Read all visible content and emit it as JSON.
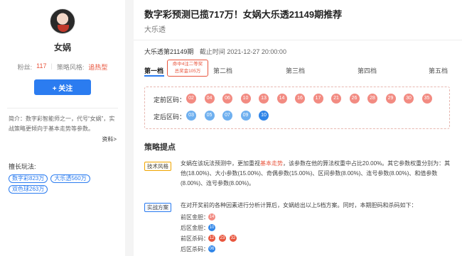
{
  "profile": {
    "name": "女娲",
    "fans_label": "粉丝:",
    "fans_count": "117",
    "style_label": "策略风格:",
    "style_value": "追热型",
    "follow_label": "+ 关注",
    "intro": "简介：数字彩智能师之一，代号“女娲”，实战策略更倾向于基本走势等参数。",
    "more_link": "资料>",
    "expertise_title": "擅长玩法:",
    "expertise_tags": [
      "数字彩823万",
      "大乐透560万",
      "双色球263万"
    ]
  },
  "article": {
    "title": "数字彩预测已揽717万！女娲大乐透21149期推荐",
    "subtitle": "大乐透",
    "issue": "大乐透第21149期",
    "deadline": "截止时间 2021-12-27 20:00:00"
  },
  "tabs": [
    {
      "label": "第一档",
      "active": true
    },
    {
      "label": "第二档",
      "active": false
    },
    {
      "label": "第三档",
      "active": false
    },
    {
      "label": "第四档",
      "active": false
    },
    {
      "label": "第五档",
      "active": false
    }
  ],
  "tab_tooltip": {
    "line1": "命中4注二等奖",
    "line2": "总奖金105万"
  },
  "balls": {
    "front_label": "定前区码：",
    "back_label": "定后区码：",
    "front": [
      "02",
      "04",
      "06",
      "10",
      "13",
      "14",
      "16",
      "17",
      "21",
      "26",
      "28",
      "29",
      "30",
      "35"
    ],
    "back": [
      "03",
      "05",
      "07",
      "09",
      "10"
    ]
  },
  "strategy": {
    "section_title": "策略提点",
    "tech_label": "技术风格",
    "tech_text_before": "女娲在该玩法预测中，更加重视",
    "tech_highlight": "基本走势",
    "tech_text_after": "，该参数在他的算法权重中占比20.00%。其它参数权重分别为：其他(18.00%)、大小参数(15.00%)、奇偶参数(15.00%)、区间参数(8.00%)、连号参数(8.00%)、和值参数(8.00%)、连号参数(8.00%)。",
    "plan_label": "实战方案",
    "plan_text": "在对开奖前的各种因素进行分析计算后，女娲给出以上5档方案。同时，本期胆码和杀码如下：",
    "front_dan_label": "前区金胆：",
    "front_dan": [
      "14"
    ],
    "back_dan_label": "后区金胆：",
    "back_dan": [
      "10"
    ],
    "front_kill_label": "前区杀码：",
    "front_kill": [
      "12",
      "23",
      "32"
    ],
    "back_kill_label": "后区杀码：",
    "back_kill": [
      "06"
    ]
  },
  "colors": {
    "accent_blue": "#2b7cf0",
    "accent_red": "#e8553d",
    "ball_red": "#f28b82",
    "ball_blue": "#6fb0ef"
  }
}
